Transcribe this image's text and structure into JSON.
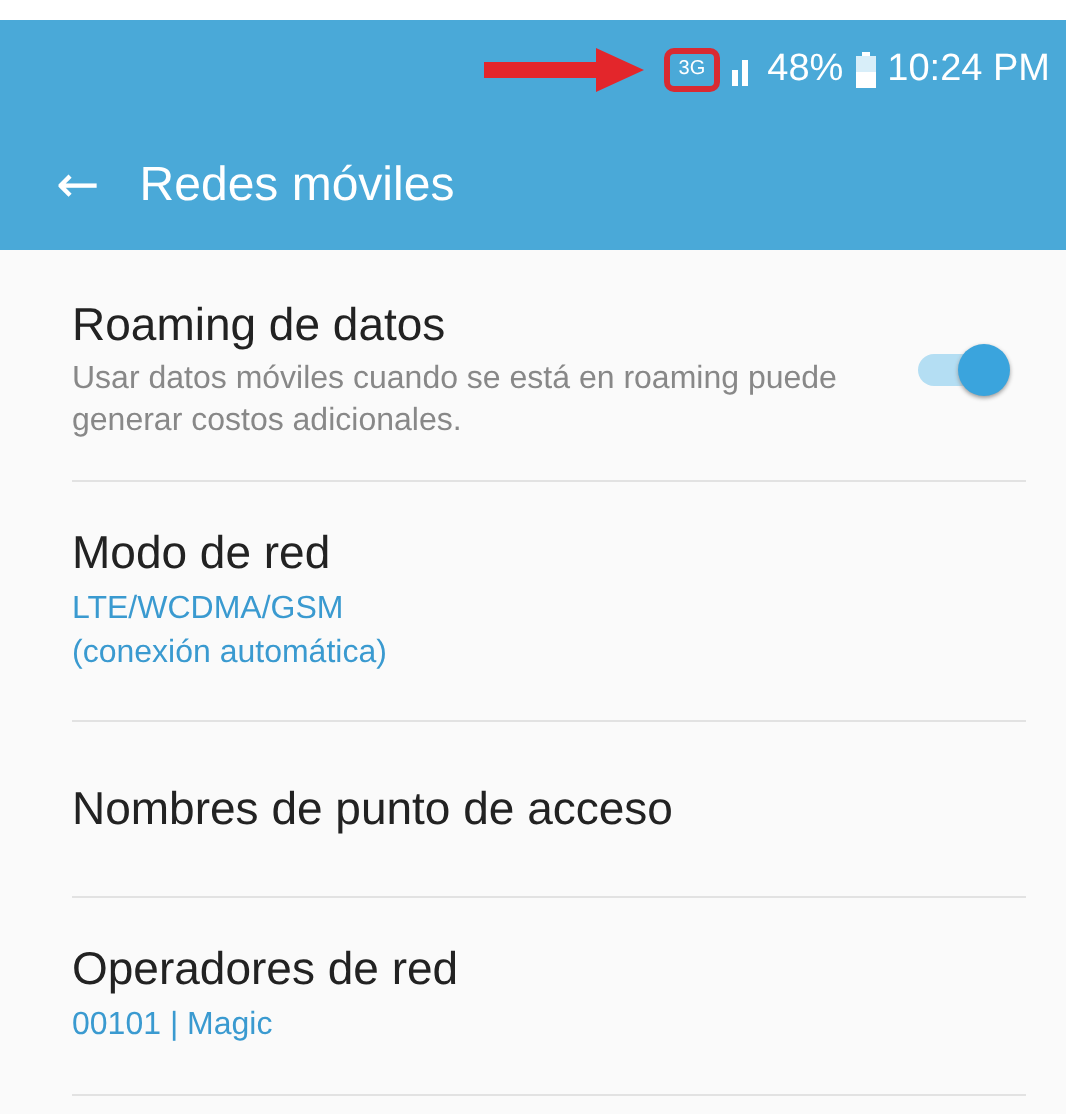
{
  "status_bar": {
    "network": "3G",
    "battery": "48%",
    "time": "10:24 PM"
  },
  "app_bar": {
    "back": "←",
    "title": "Redes móviles"
  },
  "settings": [
    {
      "kind": "switch",
      "title": "Roaming de datos",
      "summary": "Usar datos móviles cuando se está en roaming puede generar costos adicionales.",
      "on": true
    },
    {
      "kind": "value",
      "title": "Modo de red",
      "value": "LTE/WCDMA/GSM\n(conexión automática)"
    },
    {
      "kind": "plain",
      "title": "Nombres de punto de acceso"
    },
    {
      "kind": "value",
      "title": "Operadores de red",
      "value": "00101 | Magic"
    }
  ]
}
